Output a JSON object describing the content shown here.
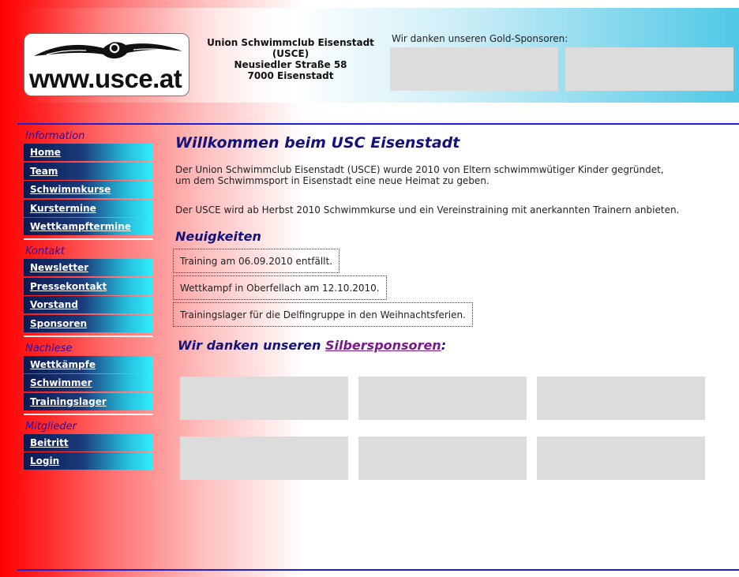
{
  "header": {
    "logo_text": "www.usce.at",
    "address_lines": [
      "Union Schwimmclub Eisenstadt",
      "(USCE)",
      "Neusiedler Straße 58",
      "7000 Eisenstadt"
    ],
    "gold_sponsors_title": "Wir danken unseren Gold-Sponsoren:"
  },
  "sidebar": {
    "sections": [
      {
        "heading": "Information",
        "items": [
          "Home",
          "Team",
          "Schwimmkurse",
          "Kurstermine",
          "Wettkampftermine"
        ]
      },
      {
        "heading": "Kontakt",
        "items": [
          "Newsletter",
          "Pressekontakt",
          "Vorstand",
          "Sponsoren"
        ]
      },
      {
        "heading": "Nachlese",
        "items": [
          "Wettkämpfe",
          "Schwimmer",
          "Trainingslager"
        ]
      },
      {
        "heading": "Mitglieder",
        "items": [
          "Beitritt",
          "Login"
        ]
      }
    ]
  },
  "main": {
    "title": "Willkommen beim USC Eisenstadt",
    "intro_line1": "Der Union Schwimmclub Eisenstadt (USCE) wurde 2010 von Eltern schwimmwütiger Kinder gegründet,",
    "intro_line2": "um dem Schwimmsport in Eisenstadt eine neue Heimat zu geben.",
    "intro2": "Der USCE wird ab Herbst 2010 Schwimmkurse und ein Vereinstraining mit anerkannten Trainern anbieten.",
    "news_title": "Neuigkeiten",
    "news": [
      "Training am 06.09.2010 entfällt.",
      "Wettkampf in Oberfellach am 12.10.2010.",
      "Trainingslager für die Delfingruppe in den Weihnachtsferien."
    ],
    "silver_prefix": "Wir danken unseren ",
    "silver_link": "Silbersponsoren",
    "silver_suffix": ":"
  },
  "colors": {
    "accent_blue": "#13137a",
    "line_blue": "#1f1fd0",
    "left_red": "#ff0000",
    "header_cyan": "#4fc8e6",
    "sponsor_box": "#dcdcdc"
  }
}
